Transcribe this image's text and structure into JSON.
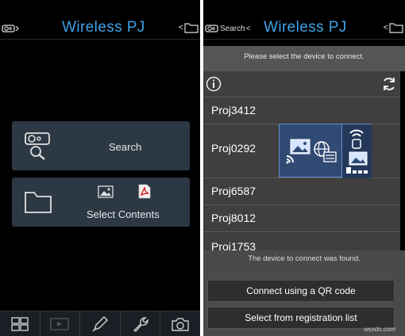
{
  "left": {
    "title": "Wireless PJ",
    "topbar_left_icon": "projector-small-icon",
    "topbar_right_icon": "folder-small-icon",
    "search_card": {
      "label": "Search",
      "icon": "projector-search-icon"
    },
    "contents_card": {
      "label": "Select Contents",
      "icons": [
        "folder-icon",
        "image-icon",
        "pdf-icon"
      ]
    },
    "toolbar": [
      "grid-icon",
      "play-icon",
      "pen-icon",
      "wrench-icon",
      "camera-icon"
    ]
  },
  "right": {
    "title": "Wireless PJ",
    "topbar_left_label": "Search",
    "prompt": "Please select the device to connect.",
    "devices": [
      {
        "name": "Proj3412"
      },
      {
        "name": "Proj0292"
      },
      {
        "name": "Proj6587"
      },
      {
        "name": "Proj8012"
      },
      {
        "name": "Proj1753"
      }
    ],
    "found_message": "The device to connect was found.",
    "qr_button": "Connect using a QR code",
    "registration_button": "Select from registration list",
    "watermark": "wsxdn.com",
    "colors": {
      "title": "#3fa2e6",
      "card": "#2c3844",
      "popup": "#304a74"
    }
  }
}
